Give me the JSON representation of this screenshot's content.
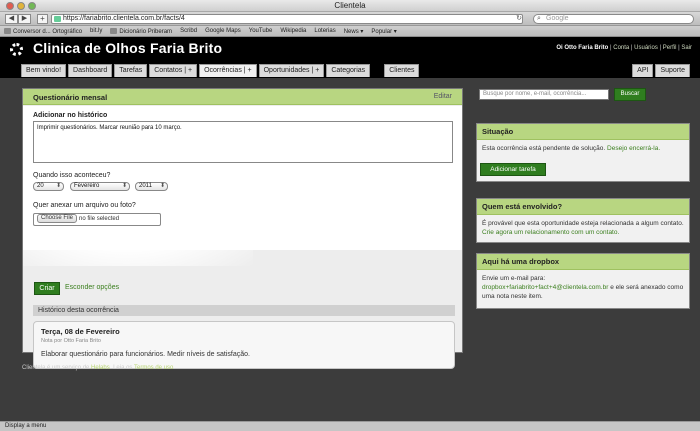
{
  "window": {
    "title": "Clientela"
  },
  "browser": {
    "url": "https://fariabrito.clientela.com.br/facts/4",
    "search_placeholder": "Google",
    "back": "◀",
    "forward": "▶",
    "add": "+",
    "bookmarks": [
      "Conversor d... Ortográfico",
      "bit.ly",
      "Dicionário Priberam",
      "Scribd",
      "Google Maps",
      "YouTube",
      "Wikipedia",
      "Loterias",
      "News ▾",
      "Popular ▾"
    ]
  },
  "header": {
    "brand": "Clinica de Olhos Faria Brito",
    "greeting": "Oi Otto Faria Brito",
    "links": [
      "Conta",
      "Usuários",
      "Perfil",
      "Sair"
    ]
  },
  "tabs": [
    "Bem vindo!",
    "Dashboard",
    "Tarefas",
    "Contatos | +",
    "Ocorrências | +",
    "Oportunidades | +",
    "Categorias",
    "Clientes"
  ],
  "tabs_right": [
    "API",
    "Suporte"
  ],
  "main": {
    "title": "Questionário mensal",
    "edit_label": "Editar",
    "add_history_label": "Adicionar no histórico",
    "note_text": "Imprimir questionários. Marcar reunião para 10 março.",
    "when_label": "Quando isso aconteceu?",
    "day": "20",
    "month": "Fevereiro",
    "year": "2011",
    "attach_label": "Quer anexar um arquivo ou foto?",
    "file_button": "Choose File",
    "file_status": "no file selected",
    "create_button": "Criar",
    "hide_options": "Esconder opções",
    "history_header": "Histórico desta ocorrência",
    "entry": {
      "date": "Terça, 08 de Fevereiro",
      "by": "Nota por Otto Faria Brito",
      "text": "Elaborar questionário para funcionários. Medir níveis de satisfação."
    }
  },
  "sidebar": {
    "search_placeholder": "Busque por nome, e-mail, ocorrência...",
    "search_button": "Buscar",
    "situacao": {
      "title": "Situação",
      "text": "Esta ocorrência está pendente de solução.",
      "link": "Desejo encerrá-la.",
      "button": "Adicionar tarefa"
    },
    "envolvido": {
      "title": "Quem está envolvido?",
      "text": "É provável que esta oportunidade esteja relacionada a algum contato.",
      "link": "Crie agora um relacionamento com um contato."
    },
    "dropbox": {
      "title": "Aqui há uma dropbox",
      "text1": "Envie um e-mail para:",
      "email": "dropbox+fariabrito+fact+4@clientela.com.br",
      "text2": "e ele será anexado como uma nota neste item."
    }
  },
  "footer": {
    "text1": "Clientela é um serviço de",
    "helabs": "Helabs",
    "text2": ". Leia os",
    "terms": "Termos de uso",
    "text3": "."
  },
  "status": "Display a menu",
  "colors": {
    "accent_green": "#b8d681",
    "button_green": "#2f7d1f",
    "header_black": "#000000"
  }
}
